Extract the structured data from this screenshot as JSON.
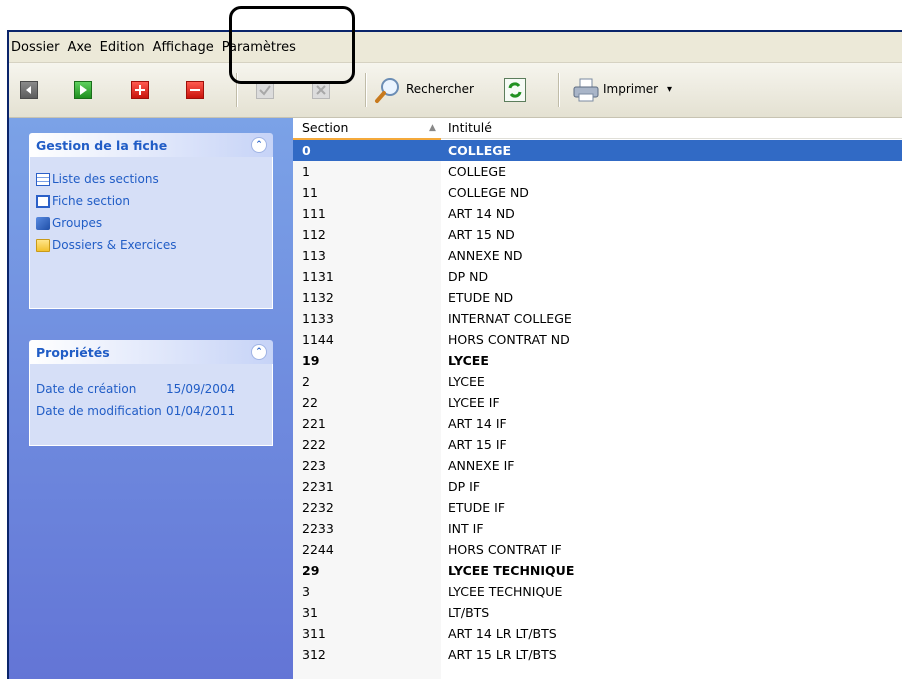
{
  "menu": [
    "Dossier",
    "Axe",
    "Edition",
    "Affichage",
    "Paramètres"
  ],
  "toolbar": {
    "search_label": "Rechercher",
    "print_label": "Imprimer",
    "print_dropdown": "▾",
    "icons": [
      "back-icon",
      "play-icon",
      "add-icon",
      "remove-icon",
      "validate-icon",
      "cancel-icon",
      "search-icon",
      "refresh-icon",
      "printer-icon"
    ],
    "colors": {
      "green": "#2fa82f",
      "red": "#e2201b"
    }
  },
  "taskpane": {
    "gestion": {
      "title": "Gestion de la fiche",
      "collapse": "⌃",
      "links": [
        "Liste des sections",
        "Fiche section",
        "Groupes",
        "Dossiers & Exercices"
      ]
    },
    "proprietes": {
      "title": "Propriétés",
      "collapse": "⌃",
      "rows": [
        {
          "label": "Date de création",
          "value": "15/09/2004"
        },
        {
          "label": "Date de modification",
          "value": "01/04/2011"
        }
      ]
    }
  },
  "list": {
    "columns": [
      "Section",
      "Intitulé"
    ],
    "sort_indicator": "▲",
    "rows": [
      {
        "section": "0",
        "intitule": "COLLEGE",
        "bold": true,
        "selected": true
      },
      {
        "section": "1",
        "intitule": "COLLEGE"
      },
      {
        "section": "11",
        "intitule": "COLLEGE ND"
      },
      {
        "section": "111",
        "intitule": "ART 14 ND"
      },
      {
        "section": "112",
        "intitule": "ART 15 ND"
      },
      {
        "section": "113",
        "intitule": "ANNEXE ND"
      },
      {
        "section": "1131",
        "intitule": "DP ND"
      },
      {
        "section": "1132",
        "intitule": "ETUDE ND"
      },
      {
        "section": "1133",
        "intitule": "INTERNAT COLLEGE"
      },
      {
        "section": "1144",
        "intitule": "HORS CONTRAT ND"
      },
      {
        "section": "19",
        "intitule": "LYCEE",
        "bold": true
      },
      {
        "section": "2",
        "intitule": "LYCEE"
      },
      {
        "section": "22",
        "intitule": "LYCEE IF"
      },
      {
        "section": "221",
        "intitule": "ART 14 IF"
      },
      {
        "section": "222",
        "intitule": "ART 15 IF"
      },
      {
        "section": "223",
        "intitule": "ANNEXE IF"
      },
      {
        "section": "2231",
        "intitule": "DP IF"
      },
      {
        "section": "2232",
        "intitule": "ETUDE IF"
      },
      {
        "section": "2233",
        "intitule": "INT IF"
      },
      {
        "section": "2244",
        "intitule": "HORS CONTRAT IF"
      },
      {
        "section": "29",
        "intitule": "LYCEE TECHNIQUE",
        "bold": true
      },
      {
        "section": "3",
        "intitule": "LYCEE TECHNIQUE"
      },
      {
        "section": "31",
        "intitule": "LT/BTS"
      },
      {
        "section": "311",
        "intitule": "ART 14 LR LT/BTS"
      },
      {
        "section": "312",
        "intitule": "ART 15 LR LT/BTS"
      }
    ]
  }
}
